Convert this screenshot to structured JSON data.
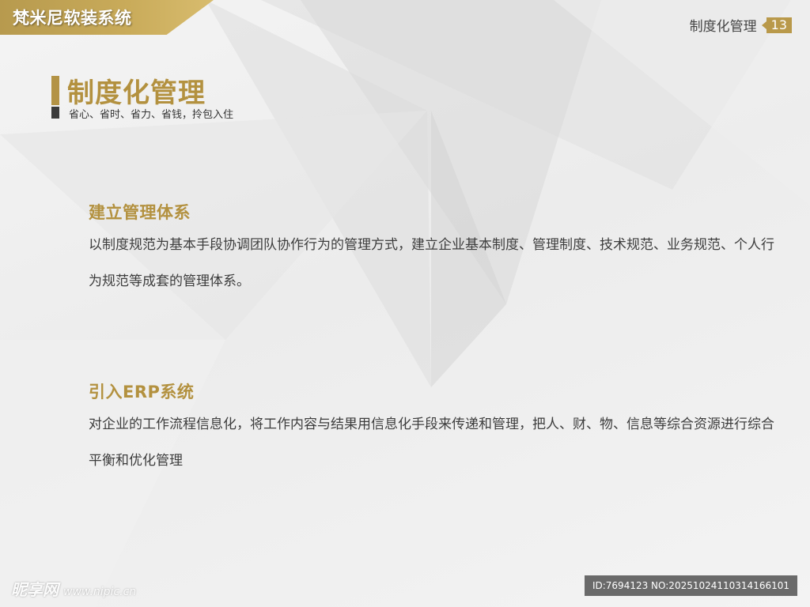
{
  "brand": {
    "name": "梵米尼软装系统"
  },
  "header": {
    "section_label": "制度化管理",
    "page_number": "13"
  },
  "title": {
    "main": "制度化管理",
    "subtitle": "省心、省时、省力、省钱，拎包入住"
  },
  "sections": [
    {
      "heading": "建立管理体系",
      "body": "以制度规范为基本手段协调团队协作行为的管理方式，建立企业基本制度、管理制度、技术规范、业务规范、个人行为规范等成套的管理体系。"
    },
    {
      "heading": "引入ERP系统",
      "body": "对企业的工作流程信息化，将工作内容与结果用信息化手段来传递和管理，把人、财、物、信息等综合资源进行综合平衡和优化管理"
    }
  ],
  "watermark": {
    "site_name": "昵享网",
    "site_url": "www.nipic.cn",
    "id_text": "ID:7694123 NO:20251024110314166101"
  },
  "colors": {
    "accent_gold": "#b3913f",
    "dark_bar": "#3b3b3b"
  }
}
